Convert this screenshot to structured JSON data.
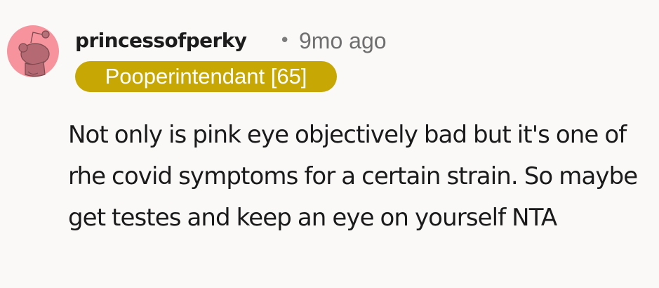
{
  "comment": {
    "author": "princessofperky",
    "separator": "•",
    "timestamp": "9mo ago",
    "flair": {
      "label": "Pooperintendant [65]",
      "background_color": "#c7a703",
      "text_color": "#ffffff"
    },
    "avatar": {
      "icon": "reddit-snoo-avatar-icon",
      "background_color": "#f6939c"
    },
    "body": "Not only is pink eye objectively bad but it's one of rhe covid symptoms for a certain strain. So maybe get testes and keep an eye on yourself NTA"
  }
}
